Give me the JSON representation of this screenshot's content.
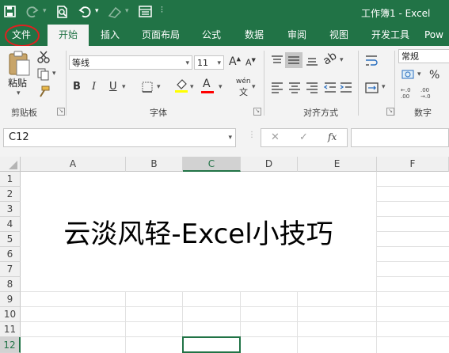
{
  "window": {
    "title": "工作簿1 - Excel"
  },
  "qat": {
    "save": "save-icon",
    "redo": "redo-icon",
    "preview": "print-preview-icon",
    "undo": "undo-icon",
    "form": "form-icon"
  },
  "tabs": [
    {
      "label": "文件"
    },
    {
      "label": "开始"
    },
    {
      "label": "插入"
    },
    {
      "label": "页面布局"
    },
    {
      "label": "公式"
    },
    {
      "label": "数据"
    },
    {
      "label": "审阅"
    },
    {
      "label": "视图"
    },
    {
      "label": "开发工具"
    },
    {
      "label": "Pow"
    }
  ],
  "ribbon": {
    "clipboard": {
      "paste_label": "粘贴",
      "group_label": "剪贴板"
    },
    "font": {
      "name": "等线",
      "size": "11",
      "group_label": "字体",
      "bold": "B",
      "italic": "I",
      "underline": "U",
      "phonetic": "wén",
      "grow": "A",
      "shrink": "A",
      "fill_color": "#ffff00",
      "font_color": "#ff0000"
    },
    "alignment": {
      "group_label": "对齐方式"
    },
    "number": {
      "format": "常规",
      "group_label": "数字",
      "percent": "%"
    }
  },
  "formula_bar": {
    "name_box": "C12",
    "fx": "fx",
    "cancel": "✕",
    "enter": "✓",
    "content": ""
  },
  "sheet": {
    "columns": [
      "A",
      "B",
      "C",
      "D",
      "E",
      "F"
    ],
    "rows": [
      "1",
      "2",
      "3",
      "4",
      "5",
      "6",
      "7",
      "8",
      "9",
      "10",
      "11",
      "12"
    ],
    "selected_cell": "C12",
    "merged_text": "云淡风轻-Excel小技巧"
  },
  "colors": {
    "accent": "#217346",
    "annotation": "#e02020"
  }
}
